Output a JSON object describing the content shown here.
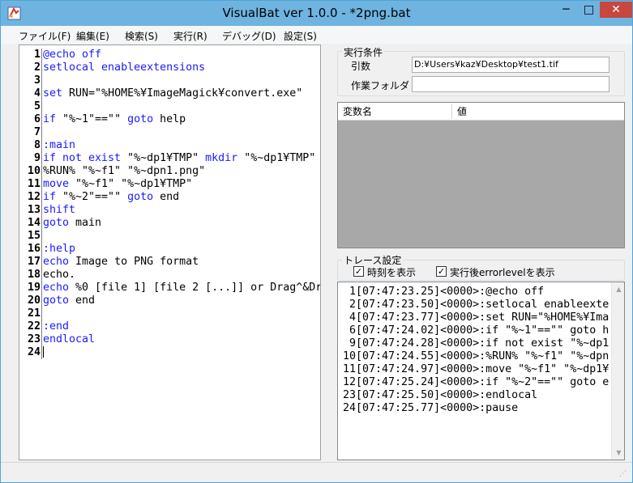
{
  "window": {
    "title": "VisualBat ver 1.0.0 - *2png.bat",
    "min_glyph": "─",
    "max_glyph": "□",
    "close_glyph": "✕",
    "app_icon": "visualbat-app-icon"
  },
  "menu": [
    {
      "label": "ファイル(F)"
    },
    {
      "label": "編集(E)"
    },
    {
      "label": "検索(S)"
    },
    {
      "label": "実行(R)"
    },
    {
      "label": "デバッグ(D)"
    },
    {
      "label": "設定(S)"
    }
  ],
  "editor": {
    "lines": [
      {
        "num": "1",
        "parts": [
          {
            "t": "@echo off",
            "k": 1
          }
        ]
      },
      {
        "num": "2",
        "parts": [
          {
            "t": "setlocal enableextensions",
            "k": 1
          }
        ]
      },
      {
        "num": "3",
        "parts": [
          {
            "t": "",
            "k": 0
          }
        ]
      },
      {
        "num": "4",
        "parts": [
          {
            "t": "set",
            "k": 1
          },
          {
            "t": " RUN=\"%HOME%¥ImageMagick¥convert.exe\"",
            "k": 0
          }
        ]
      },
      {
        "num": "5",
        "parts": [
          {
            "t": "",
            "k": 0
          }
        ]
      },
      {
        "num": "6",
        "parts": [
          {
            "t": "if",
            "k": 1
          },
          {
            "t": " \"%~1\"==\"\" ",
            "k": 0
          },
          {
            "t": "goto",
            "k": 1
          },
          {
            "t": " help",
            "k": 0
          }
        ]
      },
      {
        "num": "7",
        "parts": [
          {
            "t": "",
            "k": 0
          }
        ]
      },
      {
        "num": "8",
        "parts": [
          {
            "t": ":main",
            "k": 1
          }
        ]
      },
      {
        "num": "9",
        "parts": [
          {
            "t": "if not exist",
            "k": 1
          },
          {
            "t": " \"%~dp1¥TMP\" ",
            "k": 0
          },
          {
            "t": "mkdir",
            "k": 1
          },
          {
            "t": " \"%~dp1¥TMP\"",
            "k": 0
          }
        ]
      },
      {
        "num": "10",
        "parts": [
          {
            "t": "%RUN% \"%~f1\" \"%~dpn1.png\"",
            "k": 0
          }
        ]
      },
      {
        "num": "11",
        "parts": [
          {
            "t": "move",
            "k": 1
          },
          {
            "t": " \"%~f1\" \"%~dp1¥TMP\"",
            "k": 0
          }
        ]
      },
      {
        "num": "12",
        "parts": [
          {
            "t": "if",
            "k": 1
          },
          {
            "t": " \"%~2\"==\"\" ",
            "k": 0
          },
          {
            "t": "goto",
            "k": 1
          },
          {
            "t": " end",
            "k": 0
          }
        ]
      },
      {
        "num": "13",
        "parts": [
          {
            "t": "shift",
            "k": 1
          }
        ]
      },
      {
        "num": "14",
        "parts": [
          {
            "t": "goto",
            "k": 1
          },
          {
            "t": " main",
            "k": 0
          }
        ]
      },
      {
        "num": "15",
        "parts": [
          {
            "t": "",
            "k": 0
          }
        ]
      },
      {
        "num": "16",
        "parts": [
          {
            "t": ":help",
            "k": 1
          }
        ]
      },
      {
        "num": "17",
        "parts": [
          {
            "t": "echo",
            "k": 1
          },
          {
            "t": " Image to PNG format",
            "k": 0
          }
        ]
      },
      {
        "num": "18",
        "parts": [
          {
            "t": "echo.",
            "k": 0
          }
        ]
      },
      {
        "num": "19",
        "parts": [
          {
            "t": "echo",
            "k": 1
          },
          {
            "t": " %0 [file 1] [file 2 [...]] or Drag^&Dr",
            "k": 0
          }
        ]
      },
      {
        "num": "20",
        "parts": [
          {
            "t": "goto",
            "k": 1
          },
          {
            "t": " end",
            "k": 0
          }
        ]
      },
      {
        "num": "21",
        "parts": [
          {
            "t": "",
            "k": 0
          }
        ]
      },
      {
        "num": "22",
        "parts": [
          {
            "t": ":end",
            "k": 1
          }
        ]
      },
      {
        "num": "23",
        "parts": [
          {
            "t": "endlocal",
            "k": 1
          }
        ]
      },
      {
        "num": "24",
        "parts": [
          {
            "t": "",
            "k": 0
          }
        ]
      }
    ]
  },
  "exec": {
    "group_label": "実行条件",
    "args_label": "引数",
    "args_value": "D:¥Users¥kaz¥Desktop¥test1.tif",
    "workdir_label": "作業フォルダ",
    "workdir_value": ""
  },
  "vars": {
    "col_name": "変数名",
    "col_value": "値"
  },
  "trace": {
    "group_label": "トレース設定",
    "show_time_label": "時刻を表示",
    "show_time_checked": "✓",
    "show_errorlevel_label": "実行後errorlevelを表示",
    "show_errorlevel_checked": "✓",
    "lines": [
      " 1[07:47:23.25]<0000>:@echo off",
      " 2[07:47:23.50]<0000>:setlocal enableexte",
      " 4[07:47:23.77]<0000>:set RUN=\"%HOME%¥Ima",
      " 6[07:47:24.02]<0000>:if \"%~1\"==\"\" goto h",
      " 9[07:47:24.28]<0000>:if not exist \"%~dp1",
      "10[07:47:24.55]<0000>:%RUN% \"%~f1\" \"%~dpn",
      "11[07:47:24.97]<0000>:move \"%~f1\" \"%~dp1¥",
      "12[07:47:25.24]<0000>:if \"%~2\"==\"\" goto e",
      "23[07:47:25.50]<0000>:endlocal",
      "24[07:47:25.77]<0000>:pause"
    ]
  },
  "colors": {
    "keyword": "#1a1aff",
    "titlebar": "#6fb3e0",
    "close": "#c7483f"
  }
}
